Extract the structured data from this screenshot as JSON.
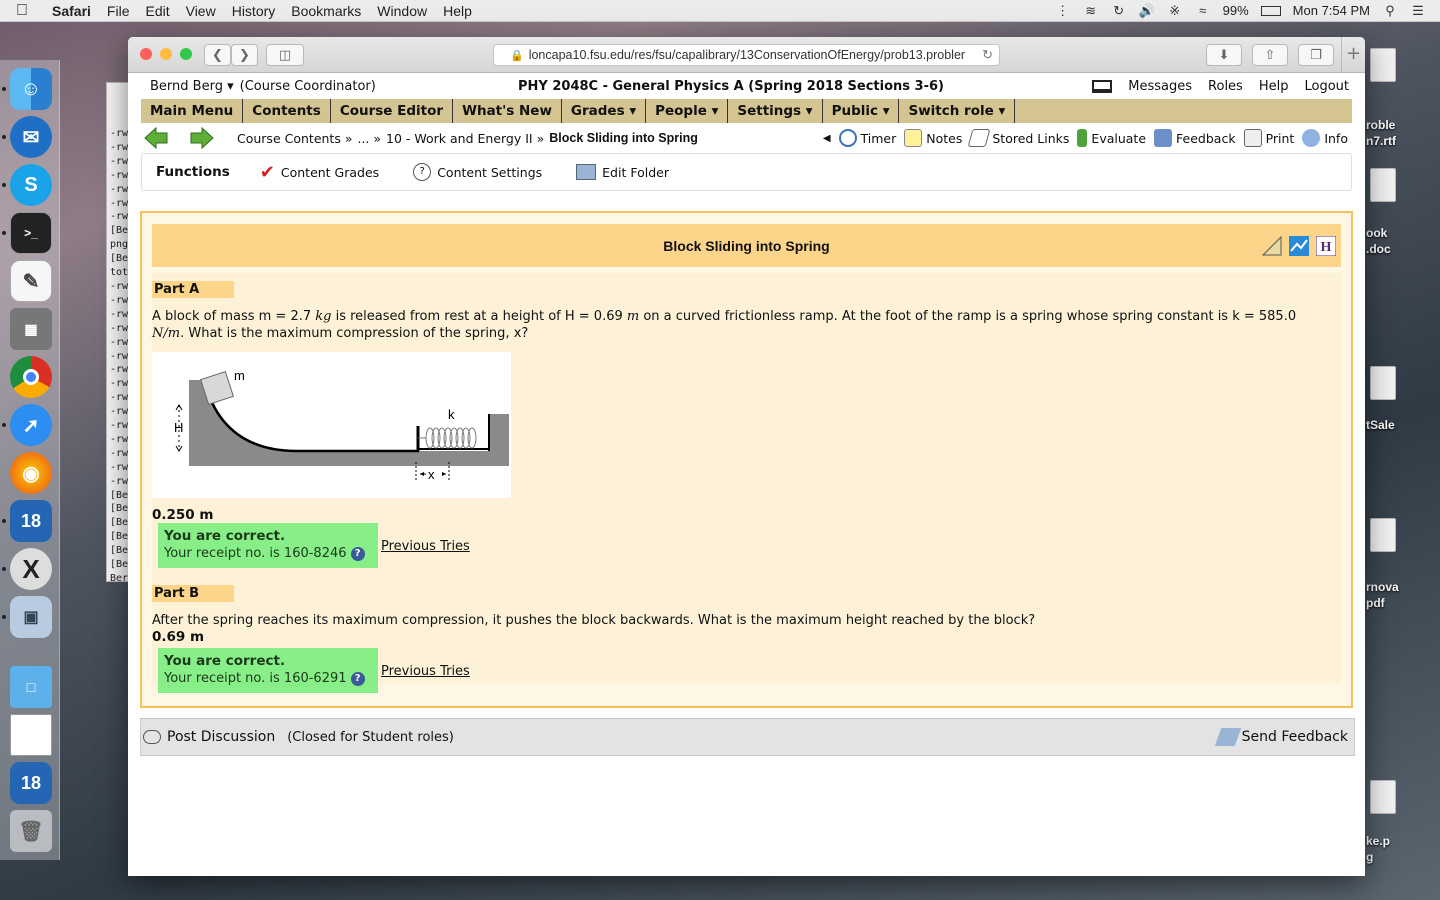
{
  "menubar": {
    "app": "Safari",
    "items": [
      "File",
      "Edit",
      "View",
      "History",
      "Bookmarks",
      "Window",
      "Help"
    ],
    "battery": "99%",
    "clock": "Mon 7:54 PM"
  },
  "terminal_strip": [
    "-rw",
    "-rw",
    "-rw",
    "-rw",
    "-rw",
    "-rw",
    "-rw",
    "[Ber",
    "png",
    "[Ber",
    "tot",
    "-rw",
    "-rw",
    "-rw",
    "-rw",
    "-rw",
    "-rw",
    "-rw",
    "-rw",
    "-rw",
    "-rw",
    "-rw",
    "-rw",
    "-rw",
    "-rw",
    "-rw",
    "[Ber",
    "[Ber",
    "[Ber",
    "[Ber",
    "[Ber",
    "[Ber",
    "Ber"
  ],
  "desktop": {
    "labels": [
      "roble",
      "n7.rtf",
      "ook",
      ".doc",
      "tSale",
      "rnova",
      "pdf",
      "ke.p",
      "g"
    ]
  },
  "browser": {
    "url": "loncapa10.fsu.edu/res/fsu/capalibrary/13ConservationOfEnergy/prob13.probler"
  },
  "lc": {
    "user": "Bernd Berg",
    "role": "(Course Coordinator)",
    "course": "PHY 2048C - General Physics A (Spring 2018 Sections 3-6)",
    "top_links": [
      "Messages",
      "Roles",
      "Help",
      "Logout"
    ],
    "menu": [
      "Main Menu",
      "Contents",
      "Course Editor",
      "What's New",
      "Grades ▾",
      "People ▾",
      "Settings ▾",
      "Public ▾",
      "Switch role ▾"
    ],
    "breadcrumb": {
      "c1": "Course Contents »",
      "c2": "... »",
      "c3": "10 - Work and Energy II »",
      "current": "Block Sliding into Spring"
    },
    "tools": [
      "Timer",
      "Notes",
      "Stored Links",
      "Evaluate",
      "Feedback",
      "Print",
      "Info"
    ],
    "functions": {
      "title": "Functions",
      "items": [
        "Content Grades",
        "Content Settings",
        "Edit Folder"
      ]
    }
  },
  "problem": {
    "title": "Block Sliding into Spring",
    "partA": {
      "label": "Part A",
      "text_pre": "A block of mass m = 2.7 ",
      "unit_kg": "kg",
      "text_mid1": " is released from rest at a height of H = 0.69 ",
      "unit_m": "m",
      "text_mid2": " on a curved frictionless ramp. At the foot of the ramp is a spring whose spring constant is k = 585.0",
      "unit_nm": "N/m",
      "text_post": ". What is the maximum compression of the spring, x?",
      "answer": "0.250 m",
      "correct": "You are correct.",
      "receipt": "Your receipt no. is 160-8246",
      "previous": "Previous Tries"
    },
    "diagram": {
      "m": "m",
      "k": "k",
      "H": "H",
      "x": "x"
    },
    "partB": {
      "label": "Part B",
      "text": "After the spring reaches its maximum compression, it pushes the block backwards. What is the maximum height reached by the block?",
      "answer": "0.69 m",
      "correct": "You are correct.",
      "receipt": "Your receipt no. is 160-6291",
      "previous": "Previous Tries"
    },
    "help_glyph": "?"
  },
  "footer": {
    "post": "Post Discussion",
    "closed": "(Closed for Student roles)",
    "send": "Send Feedback"
  }
}
